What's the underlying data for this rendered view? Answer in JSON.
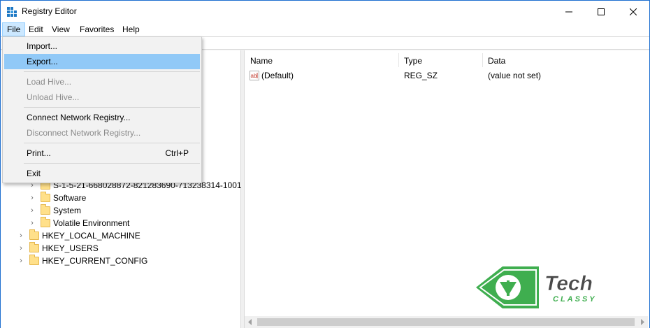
{
  "window": {
    "title": "Registry Editor"
  },
  "menubar": {
    "items": [
      {
        "label": "File"
      },
      {
        "label": "Edit"
      },
      {
        "label": "View"
      },
      {
        "label": "Favorites"
      },
      {
        "label": "Help"
      }
    ]
  },
  "file_menu": {
    "items": [
      {
        "label": "Import...",
        "enabled": true
      },
      {
        "label": "Export...",
        "enabled": true,
        "highlighted": true
      },
      {
        "label": "Load Hive...",
        "enabled": false
      },
      {
        "label": "Unload Hive...",
        "enabled": false
      },
      {
        "label": "Connect Network Registry...",
        "enabled": true
      },
      {
        "label": "Disconnect Network Registry...",
        "enabled": false
      },
      {
        "label": "Print...",
        "shortcut": "Ctrl+P",
        "enabled": true
      },
      {
        "label": "Exit",
        "enabled": true
      }
    ]
  },
  "tree": {
    "items": [
      {
        "label": "S-1-5-21-668028872-821283690-713238314-1001"
      },
      {
        "label": "Software"
      },
      {
        "label": "System"
      },
      {
        "label": "Volatile Environment"
      },
      {
        "label": "HKEY_LOCAL_MACHINE"
      },
      {
        "label": "HKEY_USERS"
      },
      {
        "label": "HKEY_CURRENT_CONFIG"
      }
    ]
  },
  "list": {
    "columns": [
      "Name",
      "Type",
      "Data"
    ],
    "rows": [
      {
        "name": "(Default)",
        "type": "REG_SZ",
        "data": "(value not set)",
        "icon": "string-value-icon"
      }
    ]
  },
  "watermark": {
    "text_main": "Tech",
    "text_sub": "CLASSY"
  },
  "colors": {
    "menu_highlight": "#91c9f7",
    "file_menu_active": "#cce8ff",
    "folder": "#ffe08a",
    "window_border": "#1e6fd0",
    "watermark_green": "#3fae4f"
  }
}
